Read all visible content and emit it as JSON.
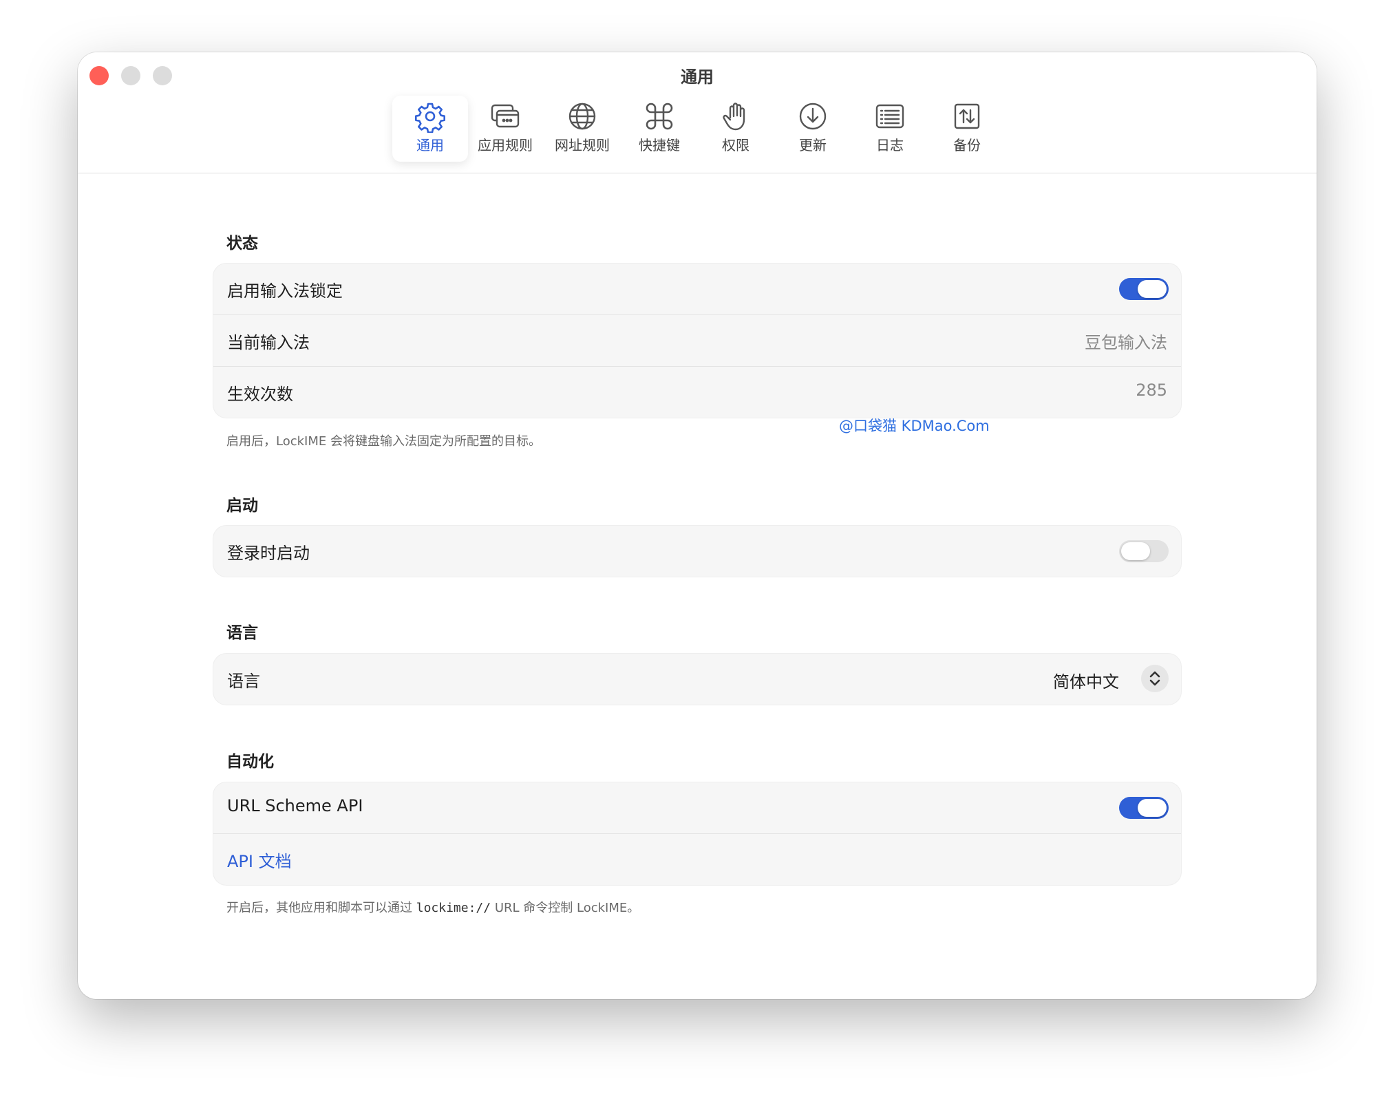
{
  "window": {
    "title": "通用"
  },
  "toolbar": {
    "tabs": [
      {
        "label": "通用",
        "icon": "gear-icon",
        "active": true
      },
      {
        "label": "应用规则",
        "icon": "app-windows-icon",
        "active": false
      },
      {
        "label": "网址规则",
        "icon": "globe-icon",
        "active": false
      },
      {
        "label": "快捷键",
        "icon": "command-icon",
        "active": false
      },
      {
        "label": "权限",
        "icon": "hand-icon",
        "active": false
      },
      {
        "label": "更新",
        "icon": "download-circle-icon",
        "active": false
      },
      {
        "label": "日志",
        "icon": "list-log-icon",
        "active": false
      },
      {
        "label": "备份",
        "icon": "backup-arrows-icon",
        "active": false
      }
    ]
  },
  "status": {
    "title": "状态",
    "enable_label": "启用输入法锁定",
    "enable_on": true,
    "current_ime_label": "当前输入法",
    "current_ime_value": "豆包输入法",
    "count_label": "生效次数",
    "count_value": "285",
    "note": "启用后，LockIME 会将键盘输入法固定为所配置的目标。"
  },
  "startup": {
    "title": "启动",
    "login_label": "登录时启动",
    "login_on": false
  },
  "language": {
    "title": "语言",
    "label": "语言",
    "selected": "简体中文"
  },
  "automation": {
    "title": "自动化",
    "url_scheme_label": "URL Scheme API",
    "url_scheme_on": true,
    "docs_link": "API 文档",
    "note_prefix": "开启后，其他应用和脚本可以通过 ",
    "note_code": "lockime://",
    "note_suffix": " URL 命令控制 LockIME。"
  },
  "watermark": "@口袋猫 KDMao.Com",
  "colors": {
    "accent": "#2f5fd6",
    "close": "#ff5f57",
    "window_bg": "#ffffff",
    "group_bg": "#f6f6f6"
  }
}
